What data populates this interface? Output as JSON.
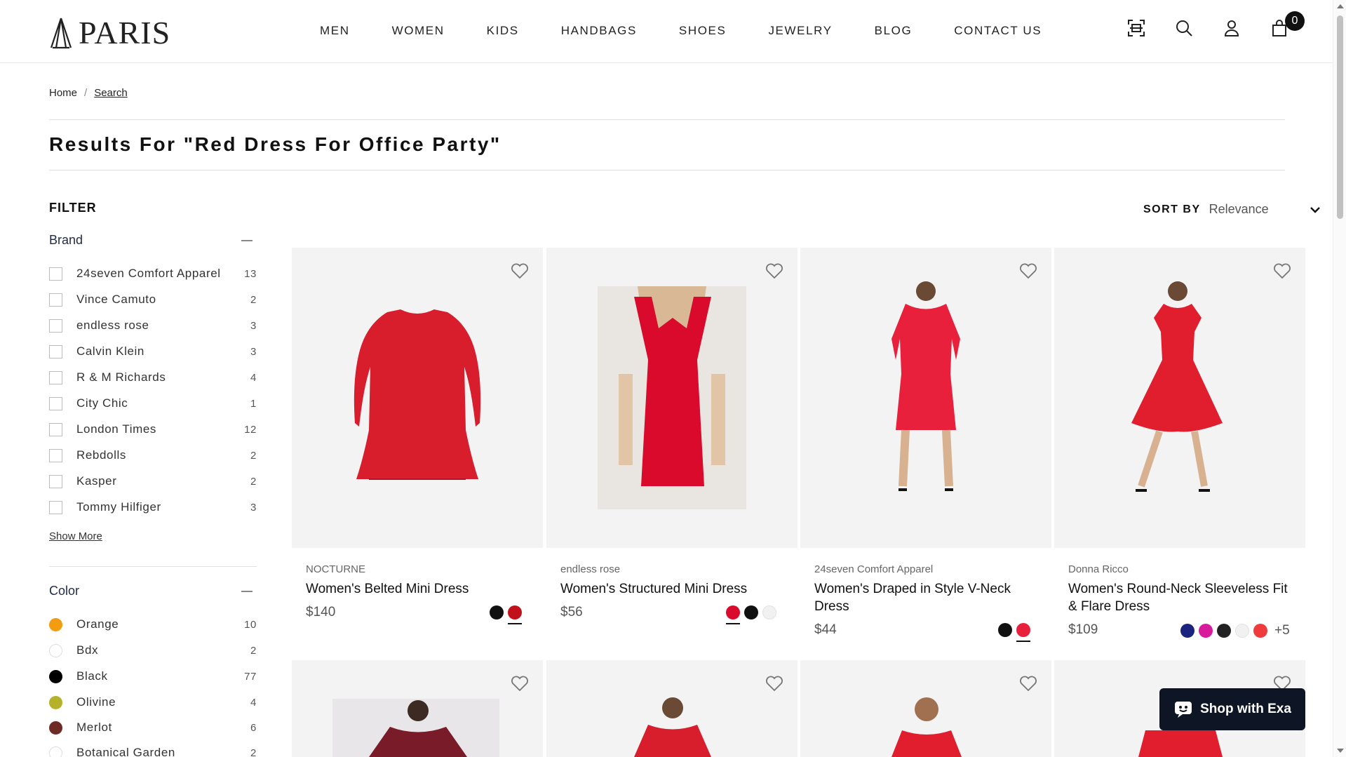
{
  "header": {
    "logo_text": "PARIS",
    "nav": [
      "MEN",
      "WOMEN",
      "KIDS",
      "HANDBAGS",
      "SHOES",
      "JEWELRY",
      "BLOG",
      "CONTACT US"
    ],
    "icons": [
      "image-search-icon",
      "search-icon",
      "account-icon",
      "cart-icon"
    ],
    "cart_count": "0"
  },
  "breadcrumb": {
    "home": "Home",
    "sep": "/",
    "current": "Search"
  },
  "results_title": "Results For \"Red Dress For Office Party\"",
  "filter": {
    "heading": "FILTER",
    "brand": {
      "title": "Brand",
      "options": [
        {
          "label": "24seven Comfort Apparel",
          "count": "13"
        },
        {
          "label": "Vince Camuto",
          "count": "2"
        },
        {
          "label": "endless rose",
          "count": "3"
        },
        {
          "label": "Calvin Klein",
          "count": "3"
        },
        {
          "label": "R & M Richards",
          "count": "4"
        },
        {
          "label": "City Chic",
          "count": "1"
        },
        {
          "label": "London Times",
          "count": "12"
        },
        {
          "label": "Rebdolls",
          "count": "2"
        },
        {
          "label": "Kasper",
          "count": "2"
        },
        {
          "label": "Tommy Hilfiger",
          "count": "3"
        }
      ],
      "show_more": "Show More"
    },
    "color": {
      "title": "Color",
      "options": [
        {
          "label": "Orange",
          "count": "10",
          "color": "#f39c12"
        },
        {
          "label": "Bdx",
          "count": "2",
          "color": "#ffffff"
        },
        {
          "label": "Black",
          "count": "77",
          "color": "#000000"
        },
        {
          "label": "Olivine",
          "count": "4",
          "color": "#b5b22a"
        },
        {
          "label": "Merlot",
          "count": "6",
          "color": "#6e2b26"
        },
        {
          "label": "Botanical Garden",
          "count": "2",
          "color": "#ffffff"
        }
      ]
    }
  },
  "sort": {
    "label": "SORT BY",
    "value": "Relevance"
  },
  "products": [
    {
      "brand": "NOCTURNE",
      "name": "Women's Belted Mini Dress",
      "price": "$140",
      "swatches": [
        "#111111",
        "#c1121c"
      ],
      "selected": 1,
      "more": ""
    },
    {
      "brand": "endless rose",
      "name": "Women's Structured Mini Dress",
      "price": "$56",
      "swatches": [
        "#d90a2c",
        "#111111",
        "#f1f1f1"
      ],
      "selected": 0,
      "more": ""
    },
    {
      "brand": "24seven Comfort Apparel",
      "name": "Women's Draped in Style V-Neck Dress",
      "price": "$44",
      "swatches": [
        "#111111",
        "#e8203c"
      ],
      "selected": 1,
      "more": ""
    },
    {
      "brand": "Donna Ricco",
      "name": "Women's Round-Neck Sleeveless Fit & Flare Dress",
      "price": "$109",
      "swatches": [
        "#1a237e",
        "#d81b9a",
        "#222222",
        "#f1f1f1",
        "#ef3b3b"
      ],
      "selected": -1,
      "more": "+5"
    }
  ],
  "chat": {
    "label": "Shop with Exa"
  },
  "colors": {
    "accent": "#111111",
    "chat_bg": "#0e1524",
    "dress_red": "#d81e2c"
  }
}
